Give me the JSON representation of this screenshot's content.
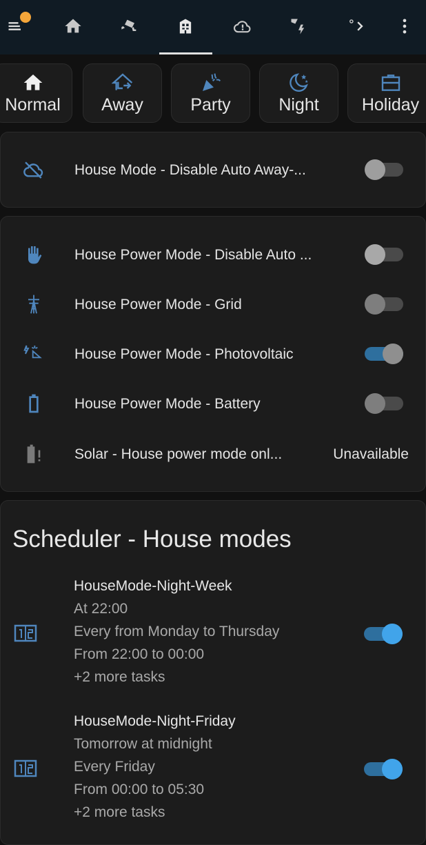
{
  "topbar": {
    "tabs": [
      {
        "icon": "menu-icon"
      },
      {
        "icon": "home-icon"
      },
      {
        "icon": "cctv-icon"
      },
      {
        "icon": "building-icon",
        "active": true
      },
      {
        "icon": "cloud-alert-icon"
      },
      {
        "icon": "solar-power-icon"
      },
      {
        "icon": "more-tabs-icon"
      },
      {
        "icon": "overflow-menu-icon"
      }
    ],
    "notification_color": "#f4a63a"
  },
  "modes": [
    {
      "label": "Normal",
      "icon": "home-icon"
    },
    {
      "label": "Away",
      "icon": "home-export-icon"
    },
    {
      "label": "Party",
      "icon": "party-popper-icon"
    },
    {
      "label": "Night",
      "icon": "weather-night-icon"
    },
    {
      "label": "Holiday",
      "icon": "briefcase-icon"
    }
  ],
  "card1": {
    "rows": [
      {
        "label": "House Mode - Disable Auto Away-...",
        "icon": "cloud-off-icon",
        "state": "off"
      }
    ]
  },
  "card2": {
    "rows": [
      {
        "label": "House Power Mode - Disable Auto ...",
        "icon": "hand-icon",
        "state": "off"
      },
      {
        "label": "House Power Mode - Grid",
        "icon": "transmission-tower-icon",
        "state": "off"
      },
      {
        "label": "House Power Mode - Photovoltaic",
        "icon": "solar-power-icon",
        "state": "on"
      },
      {
        "label": "House Power Mode - Battery",
        "icon": "battery-icon",
        "state": "off"
      },
      {
        "label": "Solar - House power mode onl...",
        "icon": "battery-alert-icon",
        "value": "Unavailable"
      }
    ]
  },
  "scheduler": {
    "title": "Scheduler - House modes",
    "entries": [
      {
        "name": "HouseMode-Night-Week",
        "next": "At 22:00",
        "days": "Every from Monday to Thursday",
        "time": "From 22:00 to 00:00",
        "more": "+2 more tasks",
        "state": "on",
        "icon": "calendar-range-icon"
      },
      {
        "name": "HouseMode-Night-Friday",
        "next": "Tomorrow at midnight",
        "days": "Every Friday",
        "time": "From 00:00 to 05:30",
        "more": "+2 more tasks",
        "state": "on",
        "icon": "calendar-range-icon"
      }
    ]
  },
  "colors": {
    "accent": "#44739e",
    "toggle_on": "#41a4ea",
    "background": "#111111",
    "card": "#1c1c1c"
  }
}
